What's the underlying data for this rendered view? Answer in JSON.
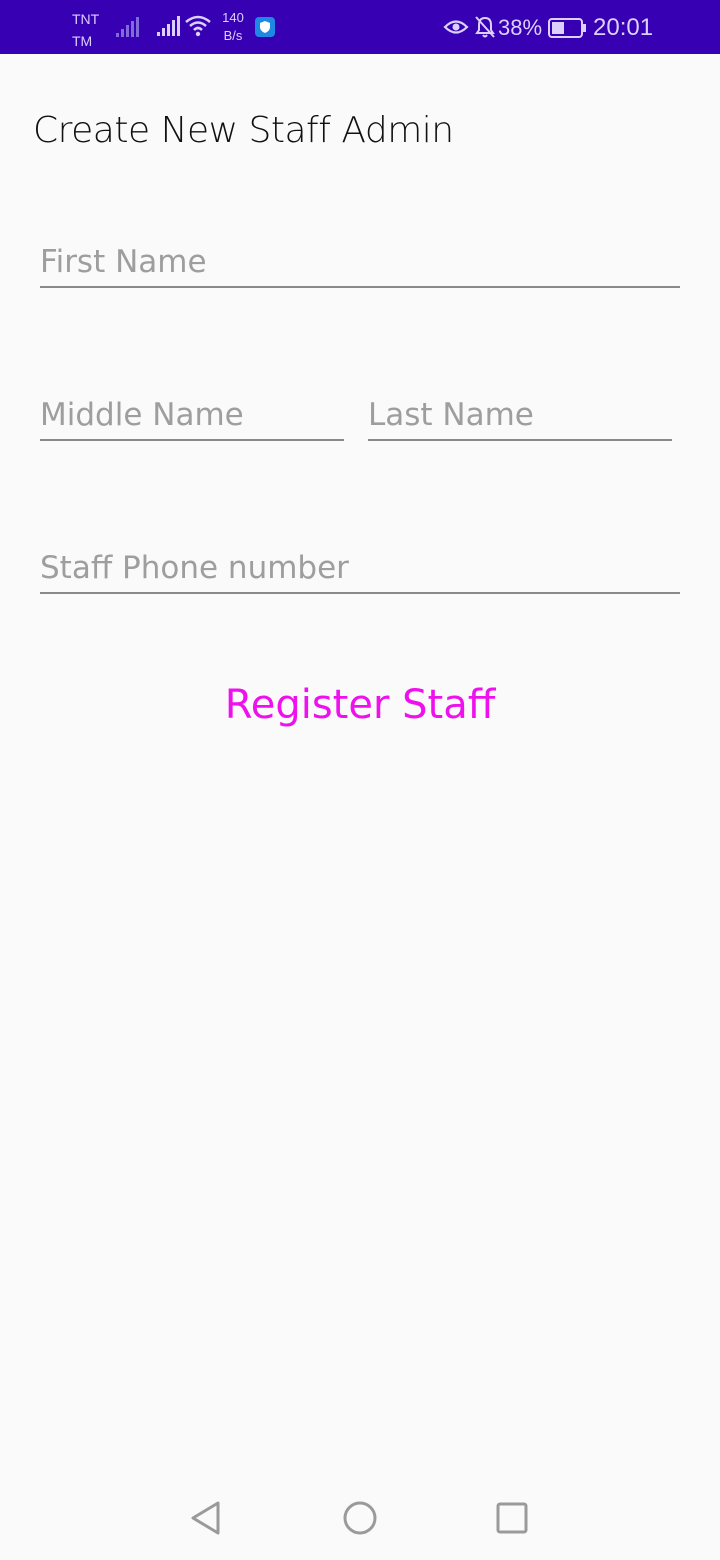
{
  "status_bar": {
    "carrier": "TNT TM",
    "network_speed": "140 B/s",
    "battery_percent": "38%",
    "time": "20:01",
    "background_color": "#3700b3",
    "icons": [
      "signal-weak-icon",
      "signal-icon",
      "wifi-icon",
      "shield-app-icon",
      "eye-comfort-icon",
      "bell-off-icon",
      "battery-icon"
    ]
  },
  "page": {
    "title": "Create New Staff Admin"
  },
  "form": {
    "first_name": {
      "value": "",
      "placeholder": "First Name"
    },
    "middle_name": {
      "value": "",
      "placeholder": "Middle Name"
    },
    "last_name": {
      "value": "",
      "placeholder": "Last Name"
    },
    "phone": {
      "value": "",
      "placeholder": "Staff Phone number"
    },
    "submit_label": "Register Staff",
    "accent_color": "#ee11ee"
  },
  "nav_bar": {
    "icons": [
      "back-icon",
      "home-icon",
      "recents-icon"
    ]
  }
}
